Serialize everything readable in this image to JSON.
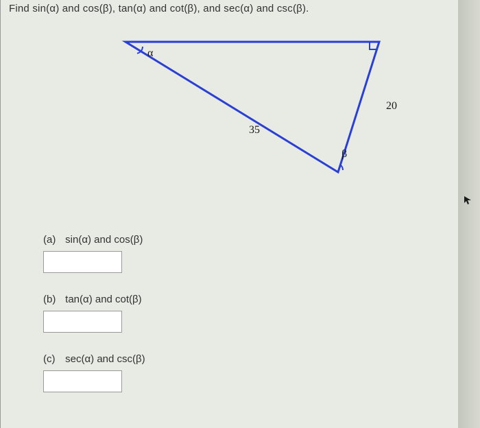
{
  "question": "Find sin(α) and cos(β), tan(α) and cot(β), and sec(α) and csc(β).",
  "triangle": {
    "alpha": "α",
    "beta": "β",
    "hypotenuse": "35",
    "side": "20"
  },
  "parts": [
    {
      "letter": "(a)",
      "text": "sin(α) and cos(β)"
    },
    {
      "letter": "(b)",
      "text": "tan(α) and cot(β)"
    },
    {
      "letter": "(c)",
      "text": "sec(α) and csc(β)"
    }
  ]
}
